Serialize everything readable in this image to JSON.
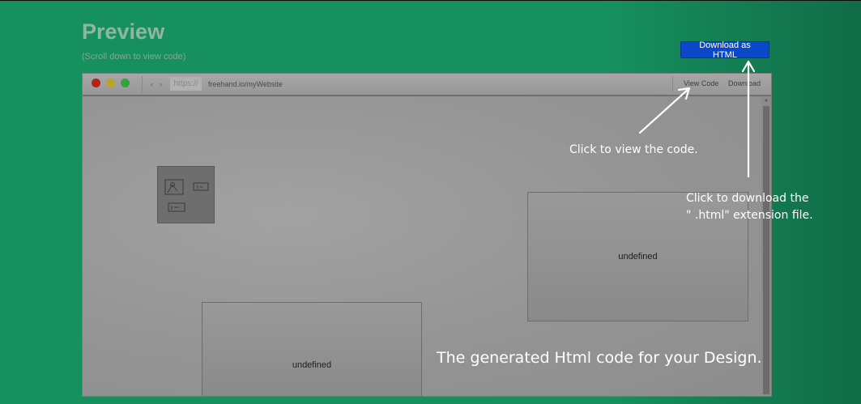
{
  "page": {
    "title": "Preview",
    "subtitle": "(Scroll down to view code)",
    "download_button_label": "Download as HTML",
    "colors": {
      "background": "#16905f",
      "button": "#0b47c9"
    }
  },
  "browser": {
    "url_scheme": "https://",
    "url": "freehand.io/myWebsite",
    "view_code_label": "View Code",
    "download_label": "Download",
    "back_icon": "‹",
    "forward_icon": "›"
  },
  "canvas": {
    "box_right_label": "undefined",
    "box_left_label": "undefined"
  },
  "annotations": {
    "view_code": "Click to view the code.",
    "download_line1": "Click to download the",
    "download_line2": "\" .html\" extension file.",
    "bottom": "The generated Html code for your Design."
  }
}
